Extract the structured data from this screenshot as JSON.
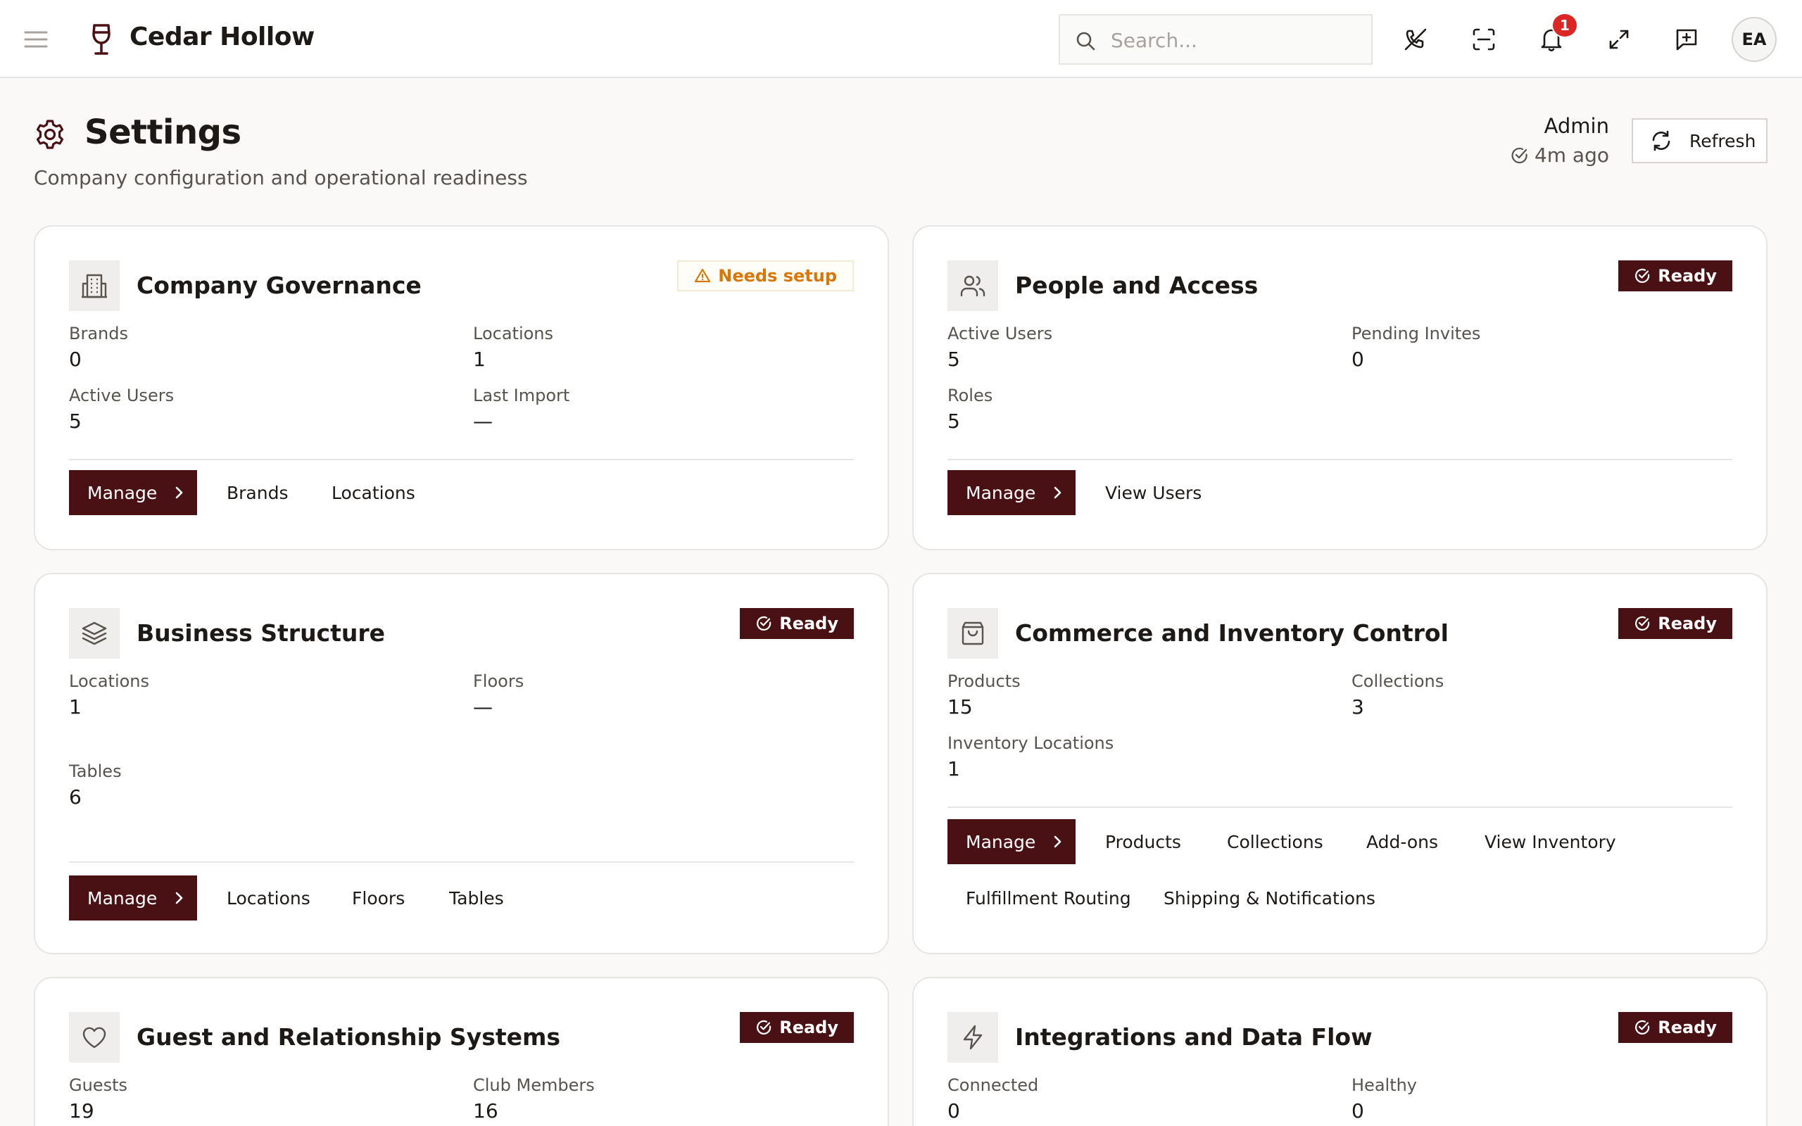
{
  "app": {
    "name": "Cedar Hollow"
  },
  "search": {
    "placeholder": "Search..."
  },
  "notifications": {
    "count": "1"
  },
  "user": {
    "initials": "EA"
  },
  "page": {
    "title": "Settings",
    "subtitle": "Company configuration and operational readiness",
    "role": "Admin",
    "updated": "4m ago",
    "refresh_label": "Refresh"
  },
  "colors": {
    "accent": "#4a1114",
    "warning": "#d97706",
    "badge_alert": "#dc2626"
  },
  "cards": [
    {
      "title": "Company Governance",
      "icon": "building-icon",
      "status": "Needs setup",
      "stats": [
        {
          "label": "Brands",
          "value": "0"
        },
        {
          "label": "Locations",
          "value": "1"
        },
        {
          "label": "Active Users",
          "value": "5"
        },
        {
          "label": "Last Import",
          "value": "—"
        }
      ],
      "manage_label": "Manage",
      "links": [
        "Brands",
        "Locations"
      ]
    },
    {
      "title": "People and Access",
      "icon": "users-icon",
      "status": "Ready",
      "stats": [
        {
          "label": "Active Users",
          "value": "5"
        },
        {
          "label": "Pending Invites",
          "value": "0"
        },
        {
          "label": "Roles",
          "value": "5"
        }
      ],
      "manage_label": "Manage",
      "links": [
        "View Users"
      ]
    },
    {
      "title": "Business Structure",
      "icon": "layers-icon",
      "status": "Ready",
      "stats": [
        {
          "label": "Locations",
          "value": "1"
        },
        {
          "label": "Floors",
          "value": "—"
        },
        {
          "label": "Tables",
          "value": "6"
        }
      ],
      "manage_label": "Manage",
      "links": [
        "Locations",
        "Floors",
        "Tables"
      ]
    },
    {
      "title": "Commerce and Inventory Control",
      "icon": "shopping-bag-icon",
      "status": "Ready",
      "stats": [
        {
          "label": "Products",
          "value": "15"
        },
        {
          "label": "Collections",
          "value": "3"
        },
        {
          "label": "Inventory Locations",
          "value": "1"
        }
      ],
      "manage_label": "Manage",
      "links": [
        "Products",
        "Collections",
        "Add-ons",
        "View Inventory",
        "Fulfillment Routing",
        "Shipping & Notifications"
      ]
    },
    {
      "title": "Guest and Relationship Systems",
      "icon": "heart-icon",
      "status": "Ready",
      "stats": [
        {
          "label": "Guests",
          "value": "19"
        },
        {
          "label": "Club Members",
          "value": "16"
        }
      ]
    },
    {
      "title": "Integrations and Data Flow",
      "icon": "lightning-icon",
      "status": "Ready",
      "stats": [
        {
          "label": "Connected",
          "value": "0"
        },
        {
          "label": "Healthy",
          "value": "0"
        }
      ]
    }
  ]
}
